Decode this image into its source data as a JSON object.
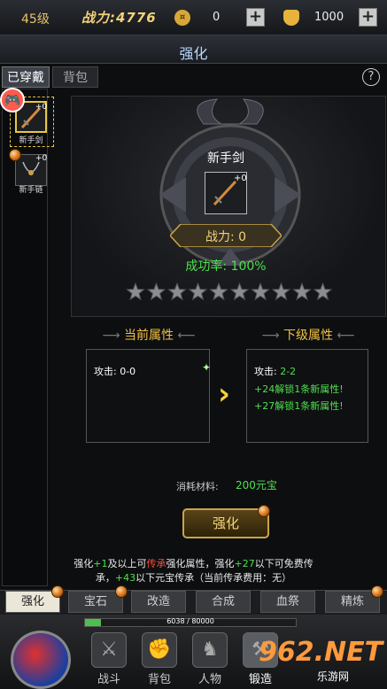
{
  "topbar": {
    "level": "45级",
    "power": "战力:4776",
    "coins": "0",
    "ingots": "1000",
    "coin_icon": "coin-icon",
    "ingot_icon": "ingot-icon"
  },
  "page_title": "强化",
  "tabs": {
    "equipped": "已穿戴",
    "bag": "背包"
  },
  "help_label": "?",
  "equipment_list": [
    {
      "name": "新手剑",
      "plus": "+0"
    },
    {
      "name": "新手链",
      "plus": "+0"
    }
  ],
  "selected_item": {
    "name": "新手剑",
    "plus": "+0",
    "power": "战力: 0",
    "success_rate": "成功率: 100%",
    "stars_total": 10,
    "stars_filled": 0
  },
  "attributes": {
    "current_title": "当前属性",
    "next_title": "下级属性",
    "current_label": "攻击:",
    "current_value": "0-0",
    "next_label": "攻击:",
    "next_value": "2-2",
    "next_unlocks": [
      "+24解锁1条新属性!",
      "+27解锁1条新属性!"
    ]
  },
  "cost": {
    "label": "消耗材料:",
    "value": "200元宝"
  },
  "enhance_button": "强化",
  "notes": {
    "line1_parts": [
      "强化",
      "+1",
      "及以上可",
      "传承",
      "强化属性，强化",
      "+27",
      "以下可免费传"
    ],
    "line2_parts": [
      "承，",
      "+43",
      "以下元宝传承（当前传承费用：无）"
    ]
  },
  "bottom_tabs": [
    "强化",
    "宝石",
    "改造",
    "合成",
    "血祭",
    "精炼"
  ],
  "xp": {
    "text": "6038 / 80000",
    "current": 6038,
    "max": 80000
  },
  "dock": [
    {
      "label": "战斗",
      "icon": "crossed-swords-icon"
    },
    {
      "label": "背包",
      "icon": "bag-icon"
    },
    {
      "label": "人物",
      "icon": "character-icon"
    },
    {
      "label": "锻造",
      "icon": "anvil-icon"
    }
  ],
  "watermark": {
    "main": "962.NET",
    "sub": "乐游网"
  },
  "colors": {
    "gold": "#f0c243",
    "green": "#4ee04e",
    "red": "#ff4a3a",
    "accent": "#b8d9ff"
  }
}
